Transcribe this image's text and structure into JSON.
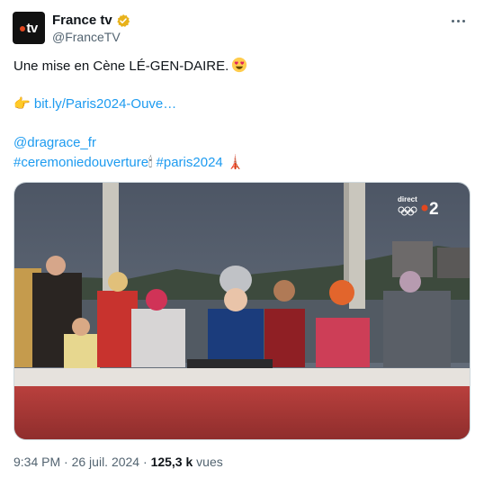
{
  "account": {
    "display_name": "France tv",
    "handle": "@FranceTV",
    "avatar_text": "tv",
    "verified_icon": "verified-badge-icon",
    "verified_color": "#e8b21b"
  },
  "tweet": {
    "line1": "Une mise en Cène LÉ-GEN-DAIRE.",
    "line1_emoji": "heart-eyes-emoji",
    "link_emoji": "👉",
    "link_text": "bit.ly/Paris2024-Ouve…",
    "mention": "@dragrace_fr",
    "hashtag1": "#ceremoniedouverture",
    "hashtag1_emoji": "🕯",
    "hashtag2": "#paris2024",
    "hashtag2_emoji": "🗼"
  },
  "media": {
    "channel_label": "direct",
    "channel_number": "2",
    "description_icon": "video-still"
  },
  "meta": {
    "time": "9:34 PM",
    "separator": " · ",
    "date": "26 juil. 2024",
    "views_count": "125,3 k",
    "views_label": " vues"
  },
  "colors": {
    "link": "#1d9bf0",
    "secondary_text": "#536471",
    "brand_accent": "#e2471f"
  }
}
